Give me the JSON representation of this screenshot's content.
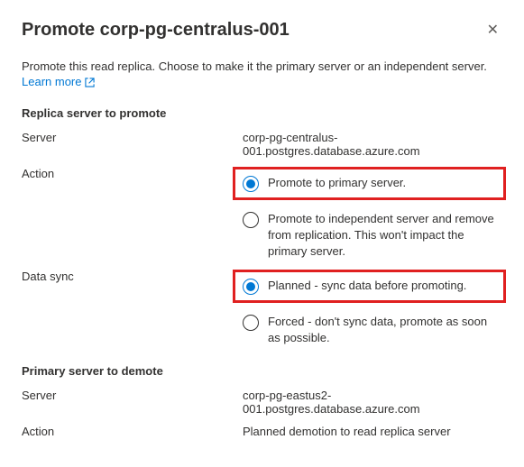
{
  "header": {
    "title": "Promote corp-pg-centralus-001",
    "close_label": "✕"
  },
  "intro": {
    "text": "Promote this read replica. Choose to make it the primary server or an independent server.",
    "learn_more": "Learn more"
  },
  "replica_section": {
    "heading": "Replica server to promote",
    "server_label": "Server",
    "server_value": "corp-pg-centralus-001.postgres.database.azure.com",
    "action_label": "Action",
    "action_options": {
      "primary": "Promote to primary server.",
      "independent": "Promote to independent server and remove from replication. This won't impact the primary server."
    },
    "datasync_label": "Data sync",
    "datasync_options": {
      "planned": "Planned - sync data before promoting.",
      "forced": "Forced - don't sync data, promote as soon as possible."
    }
  },
  "primary_section": {
    "heading": "Primary server to demote",
    "server_label": "Server",
    "server_value": "corp-pg-eastus2-001.postgres.database.azure.com",
    "action_label": "Action",
    "action_value": "Planned demotion to read replica server"
  }
}
